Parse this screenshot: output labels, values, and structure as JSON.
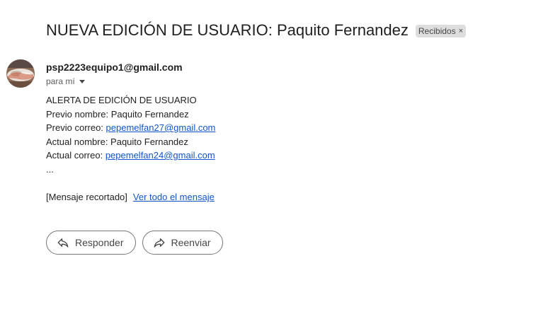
{
  "email": {
    "subject": "NUEVA EDICIÓN DE USUARIO: Paquito Fernandez",
    "label": "Recibidos",
    "label_close": "×",
    "sender": "psp2223equipo1@gmail.com",
    "to": "para mí"
  },
  "body": {
    "line1": "ALERTA DE EDICIÓN DE USUARIO",
    "line2": "Previo nombre: Paquito Fernandez",
    "line3_prefix": "Previo correo: ",
    "line3_link": "pepemelfan27@gmail.com",
    "line4": "Actual nombre: Paquito Fernandez",
    "line5_prefix": "Actual correo: ",
    "line5_link": "pepemelfan24@gmail.com",
    "ellipsis": "...",
    "clipped_notice": "[Mensaje recortado]",
    "view_full": "Ver todo el mensaje"
  },
  "actions": {
    "reply": "Responder",
    "forward": "Reenviar"
  },
  "icons": {
    "reply": "reply-arrow-icon",
    "forward": "forward-arrow-icon",
    "caret": "caret-down-icon"
  },
  "colors": {
    "link": "#1155cc",
    "chip_bg": "#dddddd"
  }
}
